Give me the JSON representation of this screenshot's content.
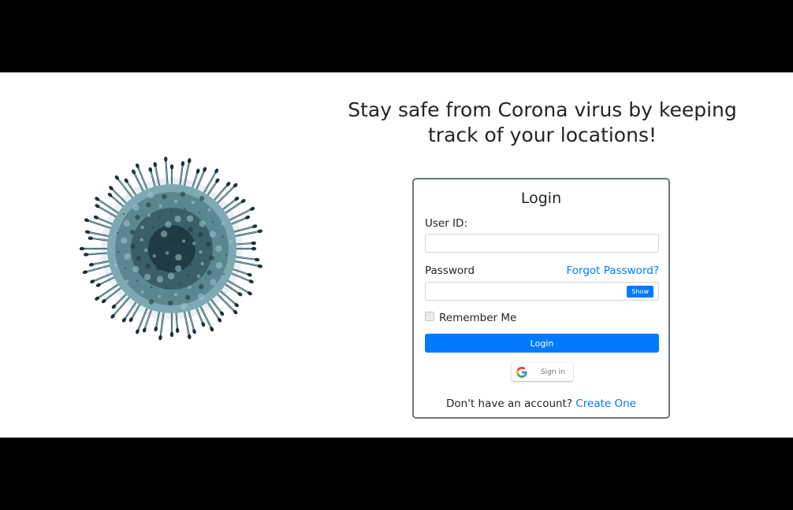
{
  "headline": "Stay safe from Corona virus by keeping track of your locations!",
  "login_card": {
    "title": "Login",
    "user_id_label": "User ID:",
    "user_id_value": "",
    "password_label": "Password",
    "password_value": "",
    "forgot_password_link": "Forgot Password?",
    "show_button": "Show",
    "remember_me_label": "Remember Me",
    "remember_me_checked": false,
    "login_button": "Login",
    "google_signin_label": "Sign in",
    "google_icon": "google-g-icon",
    "signup_prompt": "Don't have an account?",
    "signup_link": "Create One"
  },
  "hero_image": {
    "icon": "coronavirus-illustration",
    "description_colors": {
      "body": "#1f3b44",
      "spike": "#9fc7cf"
    }
  },
  "colors": {
    "primary": "#007bff",
    "text": "#212529",
    "card_border": "#6c757d",
    "letterbox": "#000000",
    "background": "#ffffff"
  }
}
